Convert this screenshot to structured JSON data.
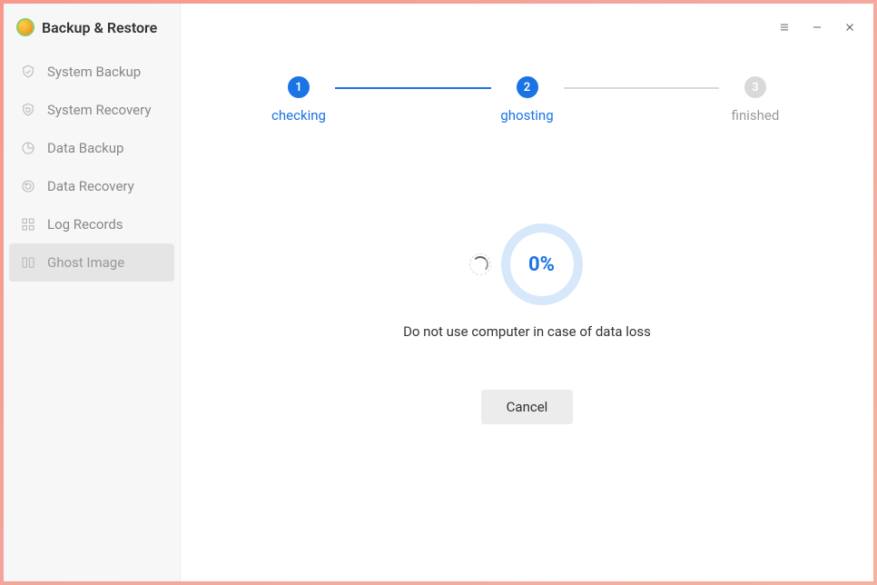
{
  "app": {
    "title": "Backup & Restore"
  },
  "sidebar": {
    "items": [
      {
        "label": "System Backup",
        "icon": "shield-check-icon",
        "active": false
      },
      {
        "label": "System Recovery",
        "icon": "shield-refresh-icon",
        "active": false
      },
      {
        "label": "Data Backup",
        "icon": "pie-icon",
        "active": false
      },
      {
        "label": "Data Recovery",
        "icon": "pie-refresh-icon",
        "active": false
      },
      {
        "label": "Log Records",
        "icon": "grid-icon",
        "active": false
      },
      {
        "label": "Ghost Image",
        "icon": "columns-icon",
        "active": true
      }
    ]
  },
  "stepper": {
    "steps": [
      {
        "num": "1",
        "label": "checking",
        "state": "active"
      },
      {
        "num": "2",
        "label": "ghosting",
        "state": "active"
      },
      {
        "num": "3",
        "label": "finished",
        "state": "inactive"
      }
    ]
  },
  "progress": {
    "percent_text": "0%",
    "message": "Do not use computer in case of data loss"
  },
  "buttons": {
    "cancel": "Cancel"
  }
}
